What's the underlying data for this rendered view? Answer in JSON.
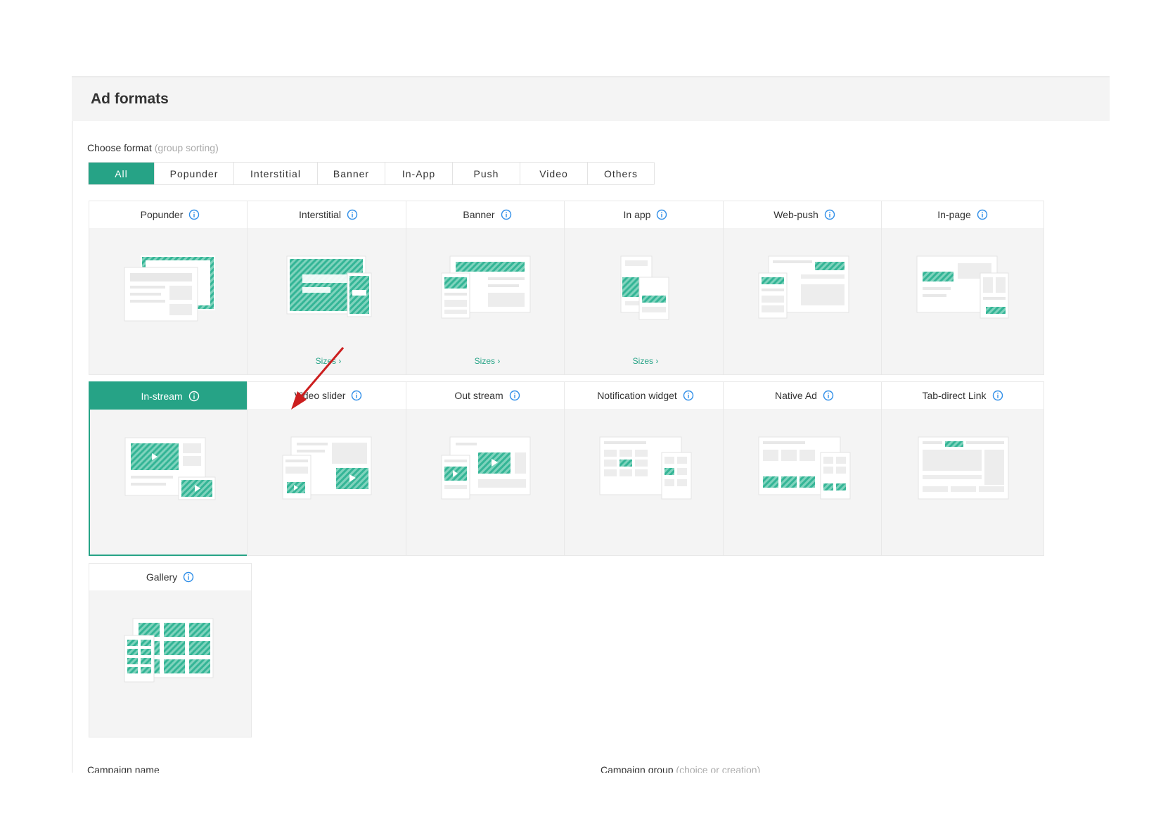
{
  "panel": {
    "title": "Ad formats"
  },
  "chooser": {
    "label": "Choose format",
    "hint": "(group sorting)"
  },
  "tabs": [
    {
      "label": "All"
    },
    {
      "label": "Popunder"
    },
    {
      "label": "Interstitial"
    },
    {
      "label": "Banner"
    },
    {
      "label": "In-App"
    },
    {
      "label": "Push"
    },
    {
      "label": "Video"
    },
    {
      "label": "Others"
    }
  ],
  "active_tab": "All",
  "formats": [
    {
      "title": "Popunder"
    },
    {
      "title": "Interstitial",
      "link": "Sizes ›"
    },
    {
      "title": "Banner",
      "link": "Sizes ›"
    },
    {
      "title": "In app",
      "link": "Sizes ›"
    },
    {
      "title": "Web-push"
    },
    {
      "title": "In-page"
    },
    {
      "title": "In-stream"
    },
    {
      "title": "Video slider"
    },
    {
      "title": "Out stream"
    },
    {
      "title": "Notification widget"
    },
    {
      "title": "Native Ad"
    },
    {
      "title": "Tab-direct Link"
    },
    {
      "title": "Gallery"
    }
  ],
  "selected_format": "In-stream",
  "fields": {
    "campaign_name_label": "Campaign name",
    "campaign_group_label": "Campaign group",
    "campaign_group_hint": "(choice or creation)"
  },
  "colors": {
    "accent": "#26a386",
    "info": "#2f8ee8",
    "annotation_arrow": "#cc1f1f"
  },
  "icons": {
    "info": "info-circle-icon",
    "arrow": "red-arrow-annotation"
  }
}
